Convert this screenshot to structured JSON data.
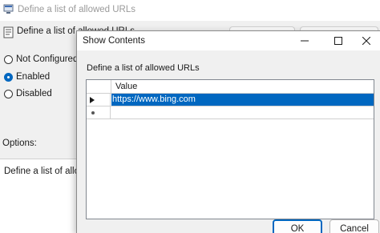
{
  "background_window": {
    "title": "Define a list of allowed URLs",
    "header_title": "Define a list of allowed URLs",
    "radio_options": [
      {
        "label": "Not Configured",
        "selected": false
      },
      {
        "label": "Enabled",
        "selected": true
      },
      {
        "label": "Disabled",
        "selected": false
      }
    ],
    "options_label": "Options:",
    "options_text": "Define a list of allowed"
  },
  "dialog": {
    "title": "Show Contents",
    "description": "Define a list of allowed URLs",
    "column_header": "Value",
    "rows": [
      {
        "value": "https://www.bing.com",
        "selected": true
      }
    ],
    "ok_label": "OK",
    "cancel_label": "Cancel"
  },
  "colors": {
    "accent": "#0067c0",
    "dialog_bg": "#f0f0f0"
  }
}
